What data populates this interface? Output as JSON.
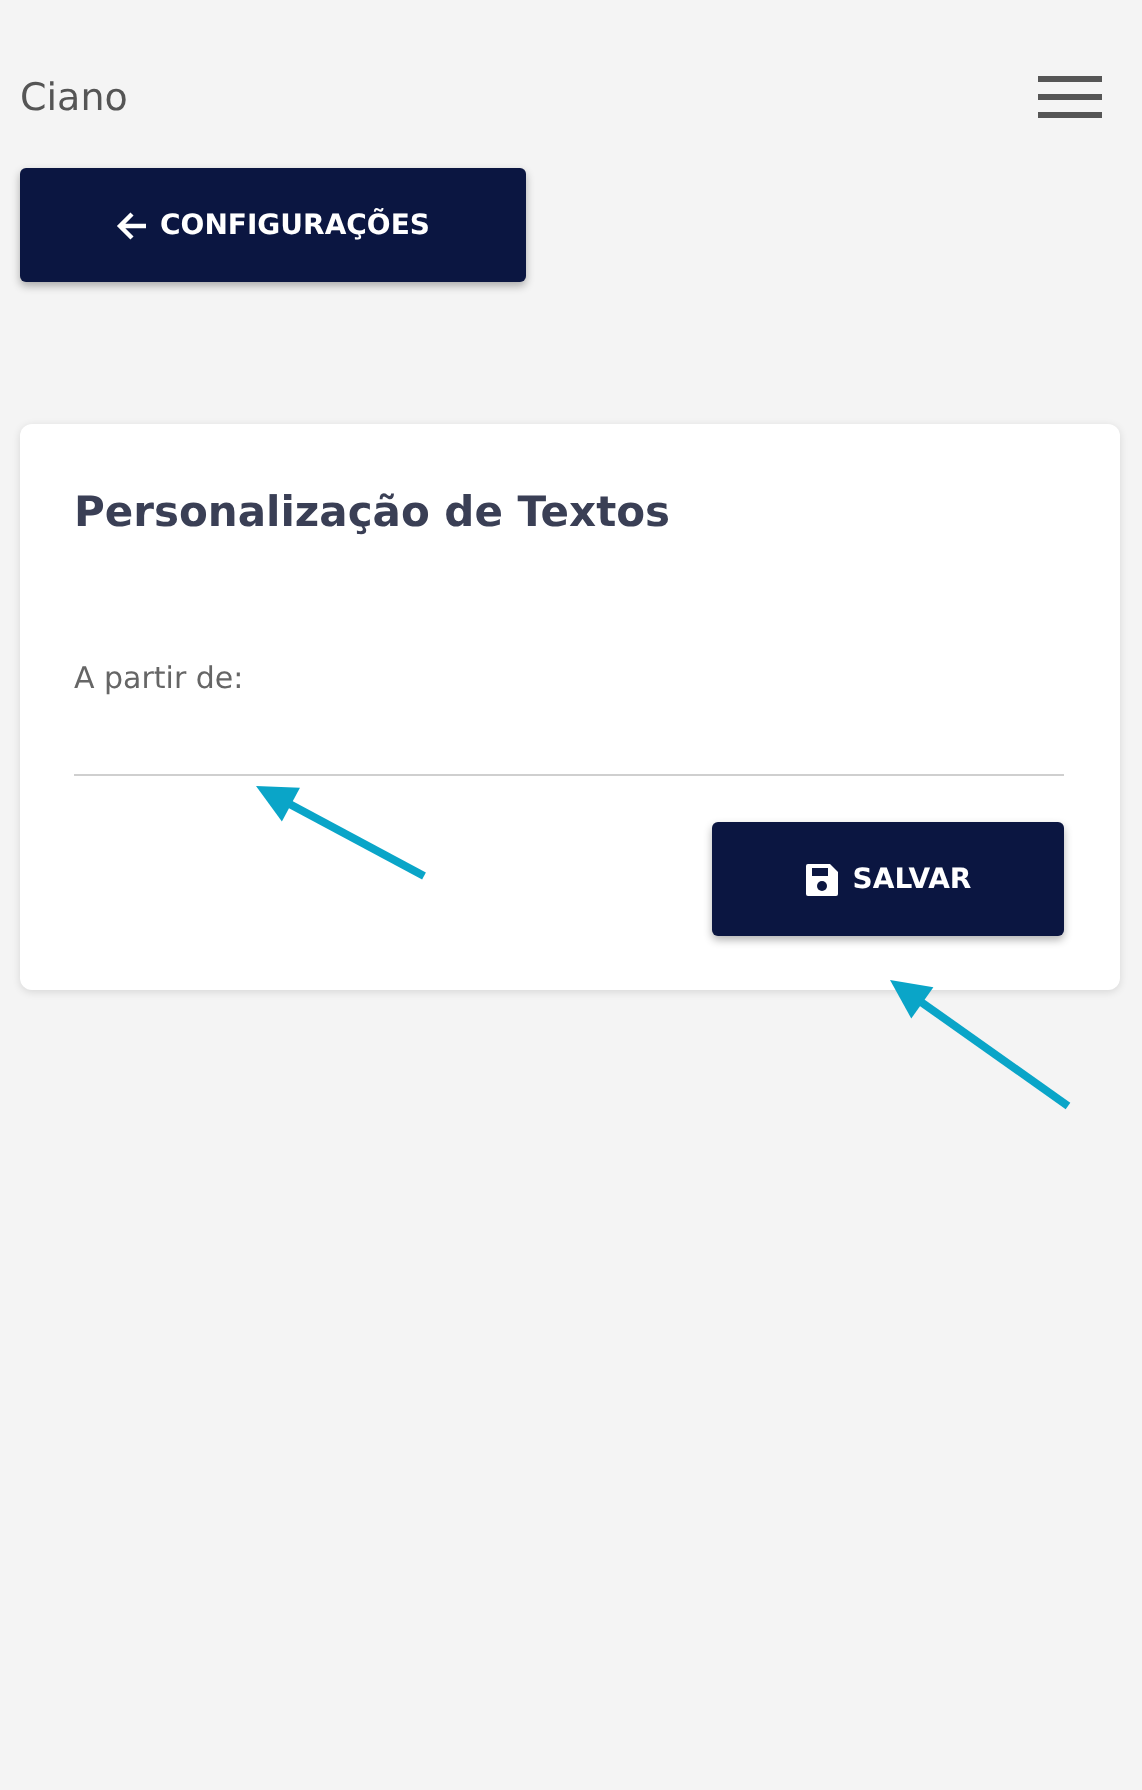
{
  "header": {
    "title": "Ciano"
  },
  "back_button": {
    "label": "CONFIGURAÇÕES"
  },
  "card": {
    "title": "Personalização de Textos",
    "field": {
      "label": "A partir de:"
    },
    "save_button": {
      "label": "SALVAR"
    }
  }
}
